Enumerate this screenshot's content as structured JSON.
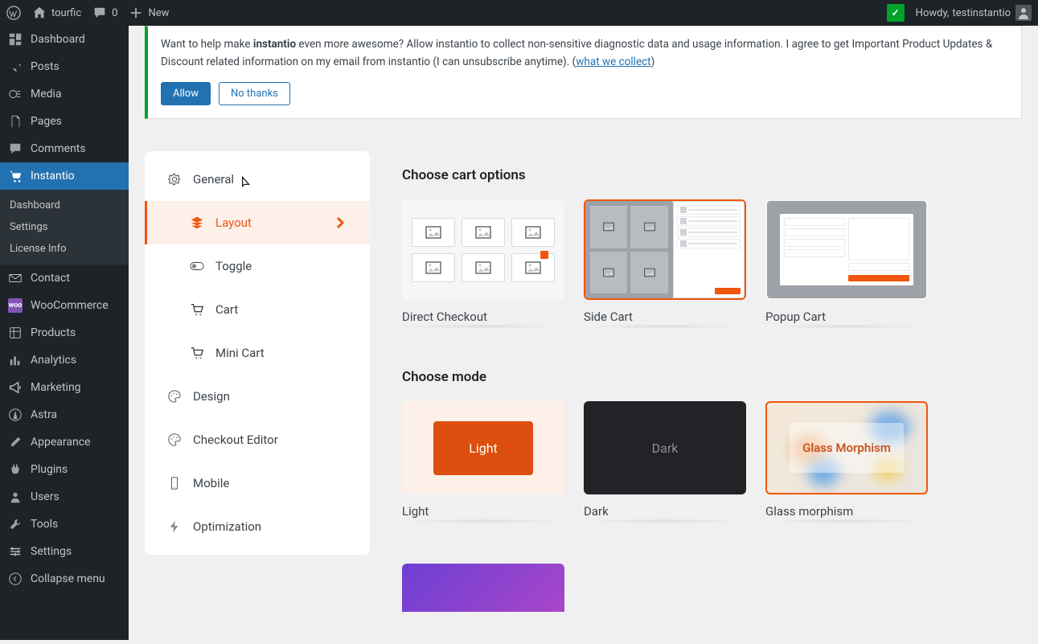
{
  "adminbar": {
    "site_name": "tourfic",
    "comments_count": "0",
    "new_label": "New",
    "howdy_prefix": "Howdy, ",
    "user_name": "testinstantio"
  },
  "wpsidebar": {
    "dashboard": "Dashboard",
    "posts": "Posts",
    "media": "Media",
    "pages": "Pages",
    "comments": "Comments",
    "instantio": "Instantio",
    "instantio_sub": {
      "dashboard": "Dashboard",
      "settings": "Settings",
      "license": "License Info"
    },
    "contact": "Contact",
    "woocommerce": "WooCommerce",
    "products": "Products",
    "analytics": "Analytics",
    "marketing": "Marketing",
    "astra": "Astra",
    "appearance": "Appearance",
    "plugins": "Plugins",
    "users": "Users",
    "tools": "Tools",
    "settings": "Settings",
    "collapse": "Collapse menu"
  },
  "notice": {
    "text_before": "Want to help make ",
    "strong": "instantio",
    "text_after": " even more awesome? Allow instantio to collect non-sensitive diagnostic data and usage information. I agree to get Important Product Updates & Discount related information on my email from instantio (I can unsubscribe anytime). (",
    "link": "what we collect",
    "text_close": ")",
    "allow": "Allow",
    "no_thanks": "No thanks"
  },
  "tabs": {
    "general": "General",
    "layout": "Layout",
    "toggle": "Toggle",
    "cart": "Cart",
    "minicart": "Mini Cart",
    "design": "Design",
    "checkout_editor": "Checkout Editor",
    "mobile": "Mobile",
    "optimization": "Optimization"
  },
  "panel": {
    "cart_options_title": "Choose cart options",
    "direct_checkout": "Direct Checkout",
    "side_cart": "Side Cart",
    "popup_cart": "Popup Cart",
    "mode_title": "Choose mode",
    "light": "Light",
    "light_btn": "Light",
    "dark": "Dark",
    "dark_btn": "Dark",
    "glass": "Glass morphism",
    "glass_btn": "Glass Morphism"
  }
}
